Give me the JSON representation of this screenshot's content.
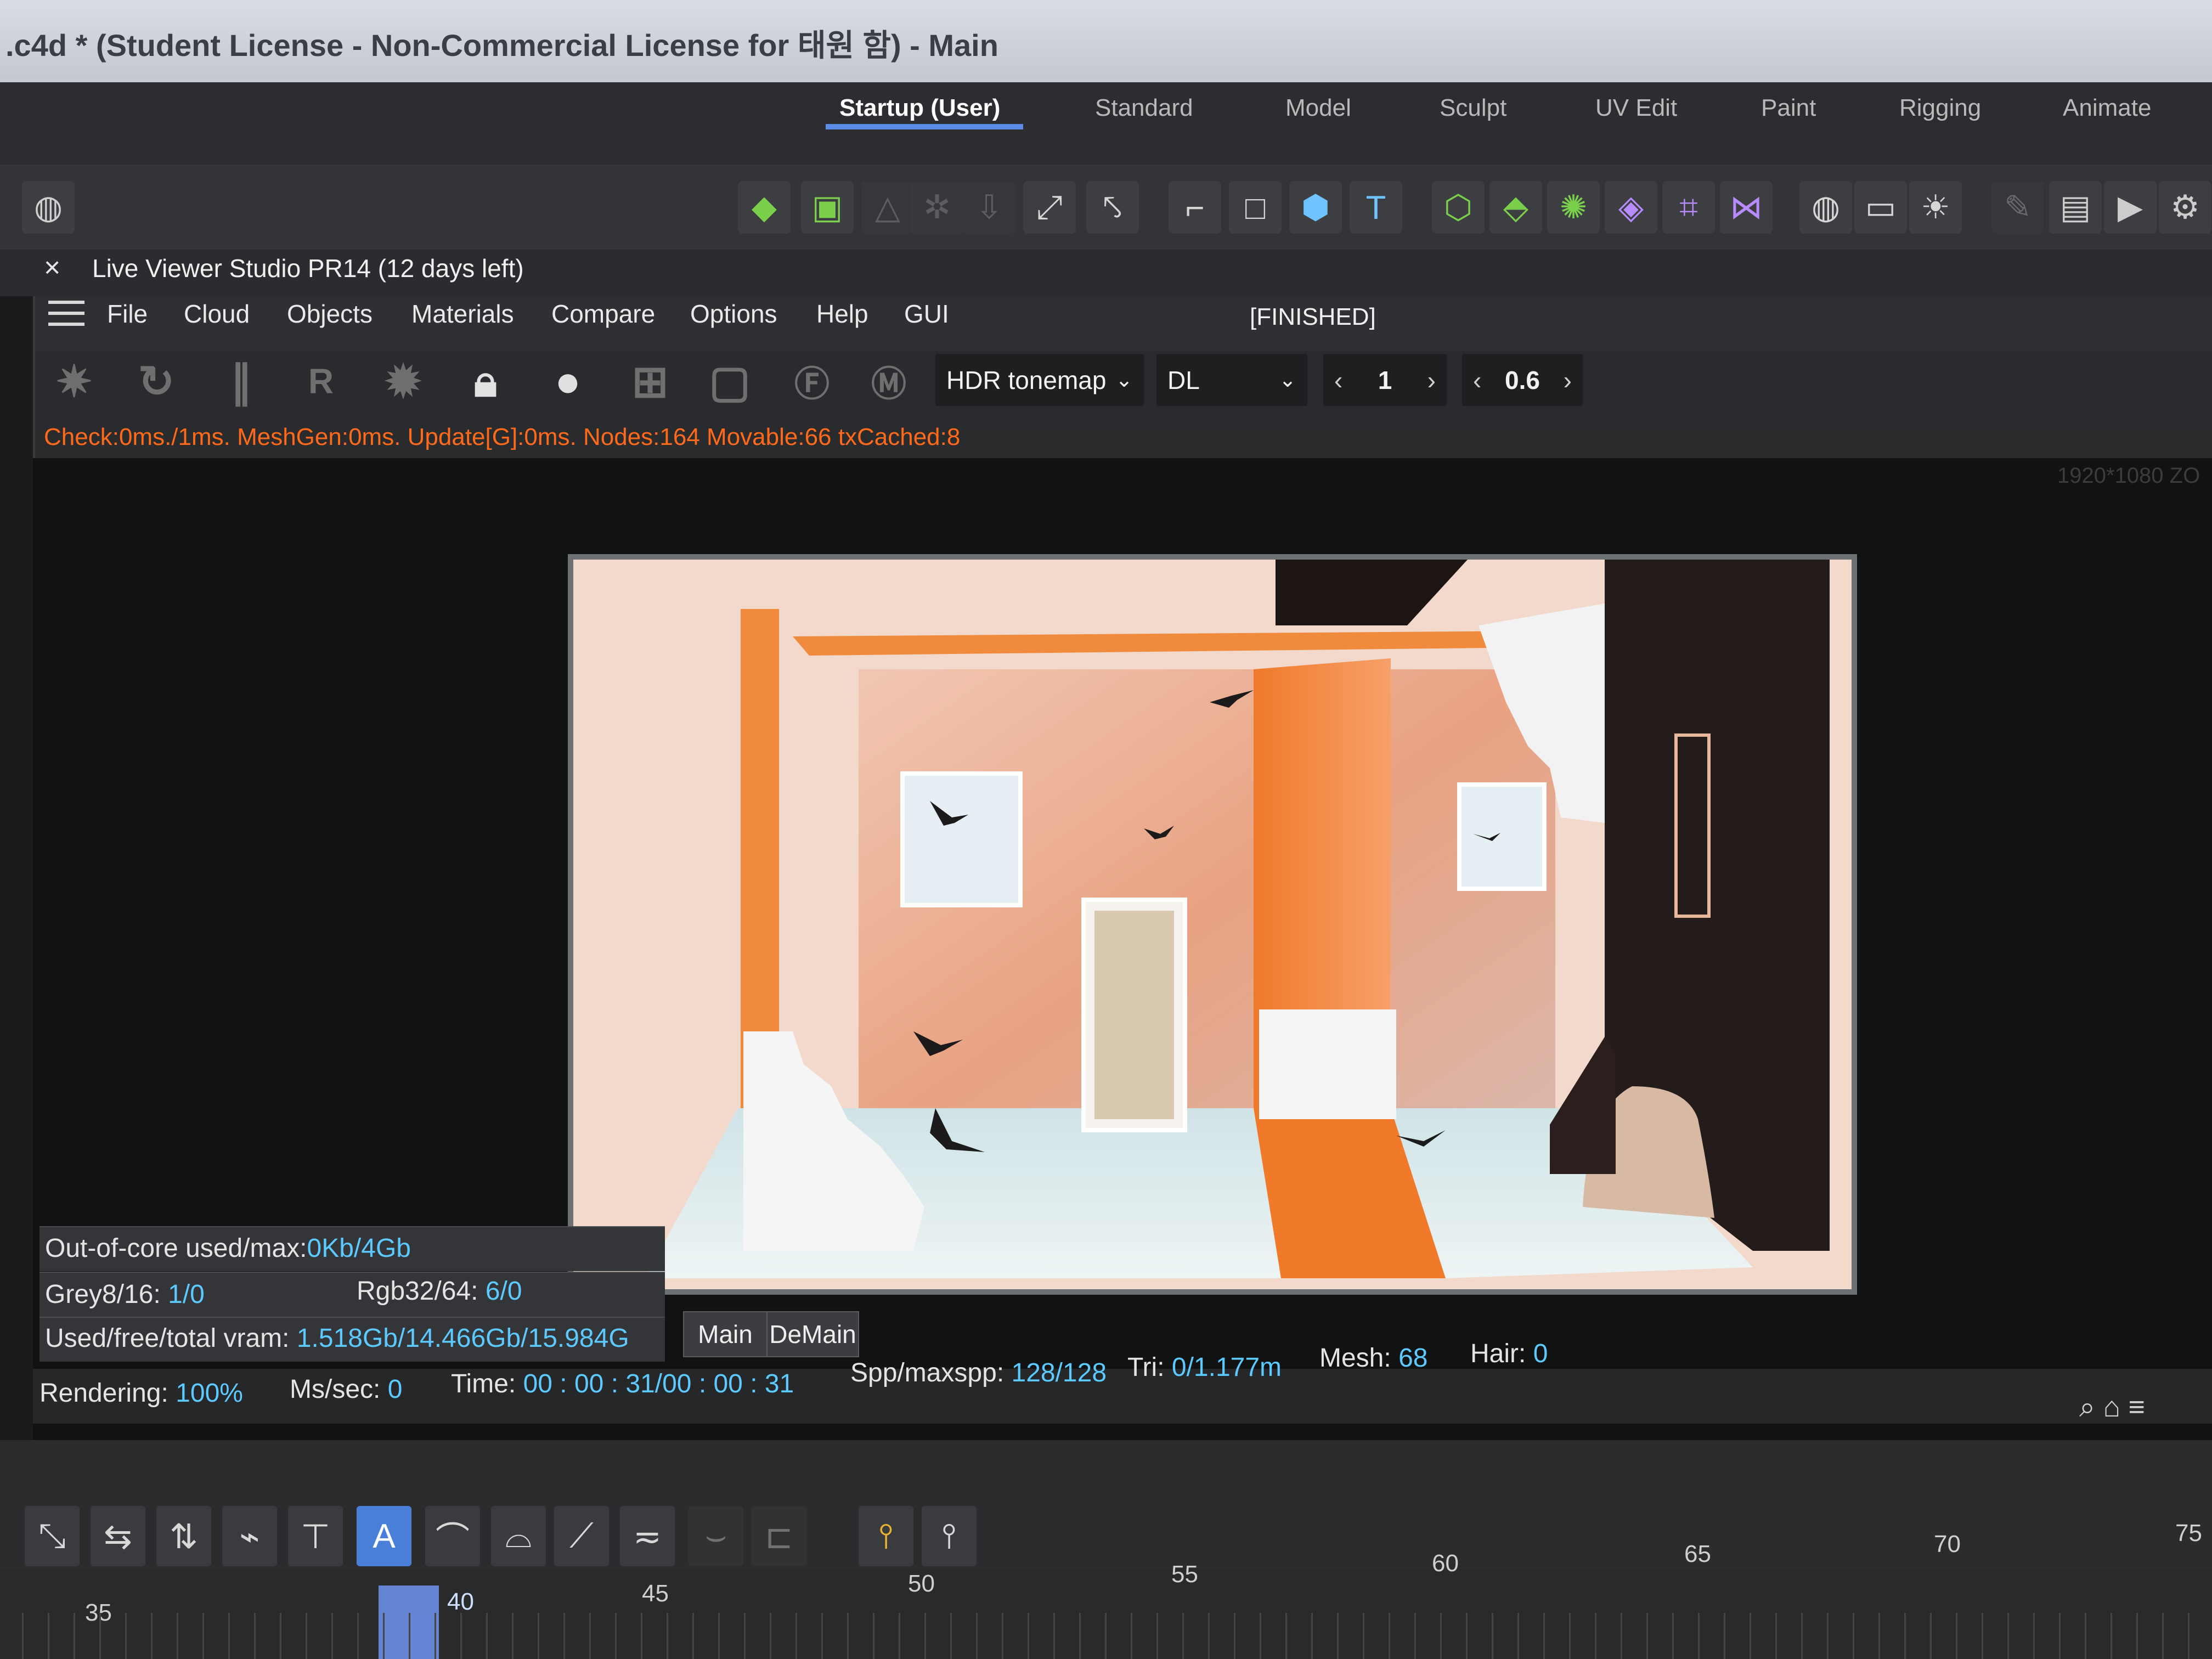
{
  "window": {
    "title": ".c4d * (Student License - Non-Commercial License for 태원 함) - Main"
  },
  "layout_tabs": [
    {
      "label": "Startup (User)",
      "active": true
    },
    {
      "label": "Standard",
      "active": false
    },
    {
      "label": "Model",
      "active": false
    },
    {
      "label": "Sculpt",
      "active": false
    },
    {
      "label": "UV Edit",
      "active": false
    },
    {
      "label": "Paint",
      "active": false
    },
    {
      "label": "Rigging",
      "active": false
    },
    {
      "label": "Animate",
      "active": false
    }
  ],
  "live_viewer": {
    "close_glyph": "×",
    "title": "Live Viewer Studio PR14 (12 days left)",
    "menu": [
      "File",
      "Cloud",
      "Objects",
      "Materials",
      "Compare",
      "Options",
      "Help",
      "GUI"
    ],
    "status": "[FINISHED]",
    "toolbar": {
      "tonemap": "HDR tonemap",
      "kernel": "DL",
      "value1": "1",
      "value2": "0.6",
      "left_arrow": "‹",
      "right_arrow": "›",
      "chevron": "⌄"
    },
    "check_line": "Check:0ms./1ms. MeshGen:0ms. Update[G]:0ms. Nodes:164 Movable:66 txCached:8",
    "resolution_label": "1920*1080 ZO",
    "left_marker": "X"
  },
  "stats": {
    "ooc_label": "Out-of-core used/max:",
    "ooc_value": "0Kb/4Gb",
    "grey_label": "Grey8/16:",
    "grey_value": "1/0",
    "rgb_label": "Rgb32/64:",
    "rgb_value": "6/0",
    "vram_label": "Used/free/total vram:",
    "vram_value": "1.518Gb/14.466Gb/15.984G",
    "rendering_label": "Rendering:",
    "rendering_value": "100%",
    "mssec_label": "Ms/sec:",
    "mssec_value": "0",
    "time_label": "Time:",
    "time_value": "00 : 00 : 31/00 : 00 : 31",
    "spp_label": "Spp/maxspp:",
    "spp_value": "128/128",
    "tri_label": "Tri:",
    "tri_value": "0/1.177m",
    "mesh_label": "Mesh:",
    "mesh_value": "68",
    "hair_label": "Hair:",
    "hair_value": "0"
  },
  "view_tabs": [
    "Main",
    "DeMain"
  ],
  "timeline": {
    "ticks": [
      "35",
      "40",
      "45",
      "50",
      "55",
      "60",
      "65",
      "70",
      "75"
    ]
  },
  "colors": {
    "accent": "#5b8de8",
    "stat_value": "#5cc9ff",
    "warning_text": "#ff6a1a",
    "render_orange": "#f08a3c"
  }
}
